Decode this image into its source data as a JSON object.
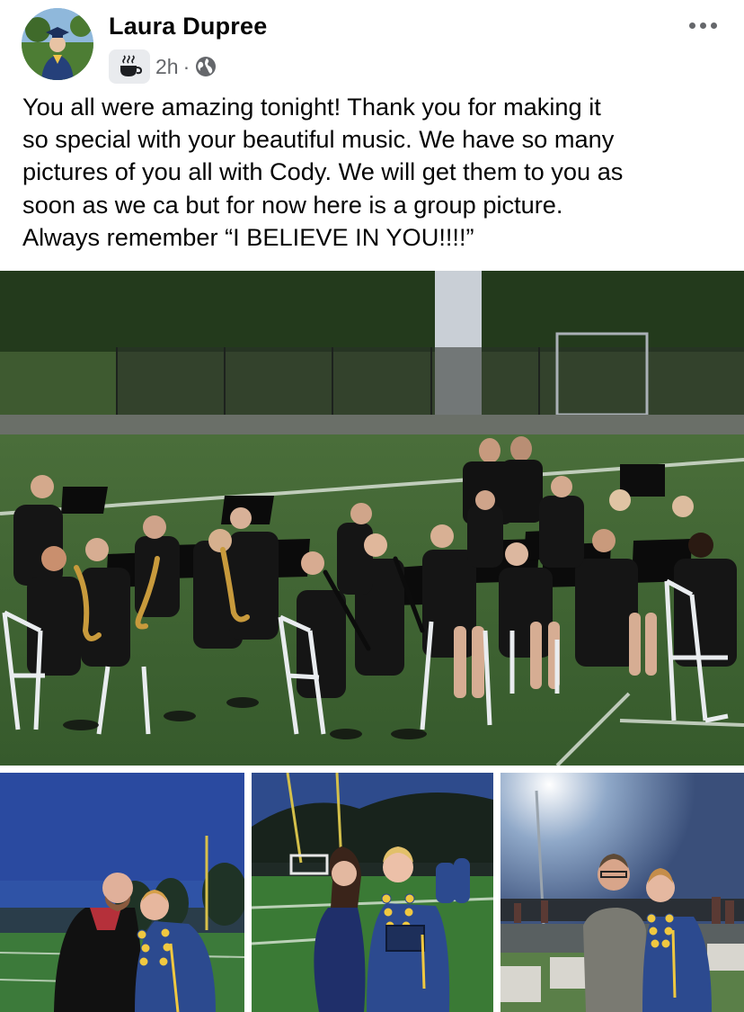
{
  "post": {
    "author_name": "Laura Dupree",
    "timestamp": "2h",
    "separator": "·",
    "badge_icon": "coffee-cup-icon",
    "privacy_icon": "globe-icon",
    "menu_icon": "more-options-icon",
    "avatar_icon": "graduate-avatar-icon",
    "text_lines": [
      "You all were amazing tonight!   Thank you for making it",
      "so special with your beautiful music.  We have so many",
      "pictures of you all with Cody.   We will get them to you as",
      "soon as we ca but for now here is a group picture.",
      "Always remember “I BELIEVE IN YOU!!!!”"
    ]
  },
  "photos": {
    "main": "band-group-photo",
    "thumbs": [
      "graduate-with-teacher-photo",
      "graduate-with-woman-photo",
      "graduate-with-man-photo"
    ]
  },
  "colors": {
    "text": "#050505",
    "secondary": "#65676b",
    "badge_bg": "#e9ebee",
    "field_green": "#3f6b35",
    "night_sky": "#2f4f9e",
    "gown_blue": "#2c4a8f"
  }
}
